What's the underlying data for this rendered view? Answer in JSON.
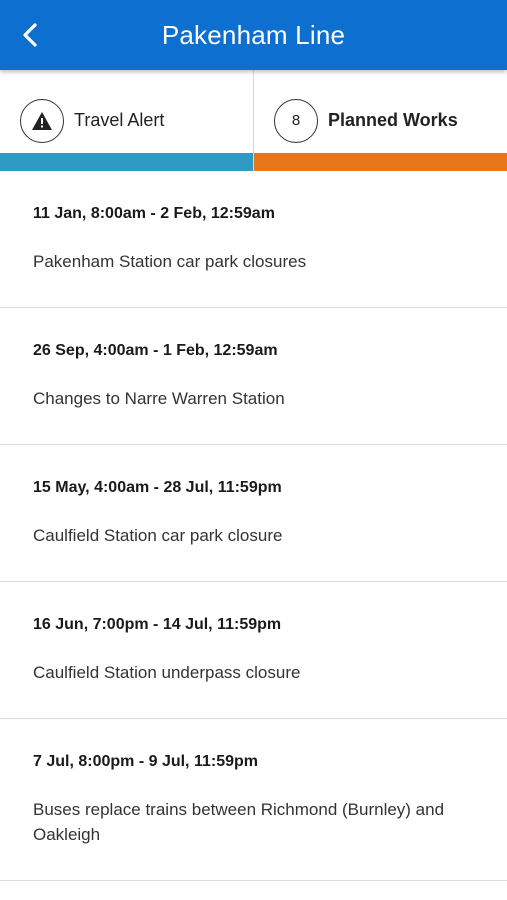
{
  "header": {
    "title": "Pakenham Line",
    "back_icon": "chevron-left-icon"
  },
  "tabs": [
    {
      "label": "Travel Alert",
      "icon": "warning-triangle-icon",
      "bar_color": "#2f9bc4"
    },
    {
      "label": "Planned Works",
      "count": "8",
      "bar_color": "#e8761d"
    }
  ],
  "works": [
    {
      "date": "11 Jan, 8:00am - 2 Feb, 12:59am",
      "desc": "Pakenham Station car park closures"
    },
    {
      "date": "26 Sep, 4:00am - 1 Feb, 12:59am",
      "desc": "Changes to Narre Warren Station"
    },
    {
      "date": "15 May, 4:00am - 28 Jul, 11:59pm",
      "desc": "Caulfield Station car park closure"
    },
    {
      "date": "16 Jun, 7:00pm - 14 Jul, 11:59pm",
      "desc": "Caulfield Station underpass closure"
    },
    {
      "date": "7 Jul, 8:00pm - 9 Jul, 11:59pm",
      "desc": "Buses replace trains between Richmond (Burnley) and Oakleigh"
    }
  ],
  "colors": {
    "header": "#0d6fcf",
    "alert_bar": "#2f9bc4",
    "works_bar": "#e8761d"
  }
}
